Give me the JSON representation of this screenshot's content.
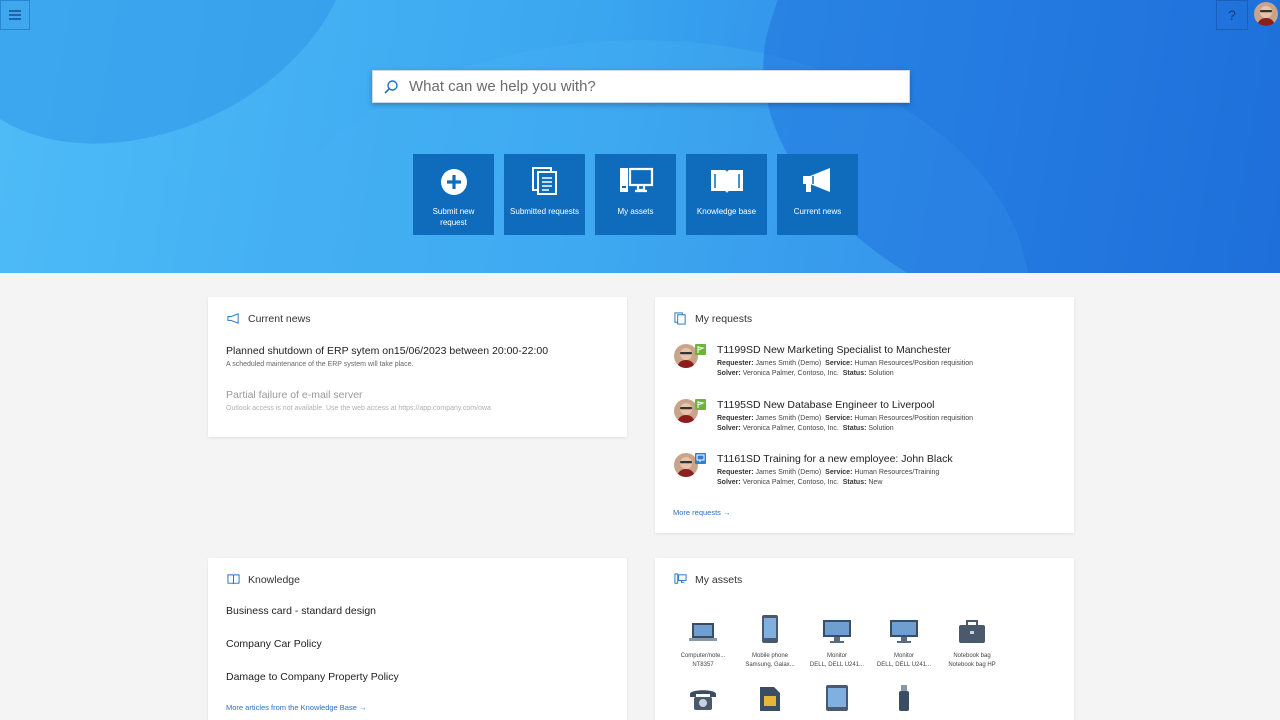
{
  "search": {
    "placeholder": "What can we help you with?"
  },
  "header": {
    "help_label": "?"
  },
  "tiles": [
    {
      "label": "Submit new request",
      "icon": "plus-circle-icon"
    },
    {
      "label": "Submitted requests",
      "icon": "documents-icon"
    },
    {
      "label": "My assets",
      "icon": "computer-icon"
    },
    {
      "label": "Knowledge base",
      "icon": "book-icon"
    },
    {
      "label": "Current news",
      "icon": "megaphone-icon"
    }
  ],
  "news": {
    "title": "Current news",
    "items": [
      {
        "title": "Planned shutdown of ERP sytem on15/06/2023 between 20:00-22:00",
        "subtitle": "A scheduled maintenance of the ERP system will take place."
      },
      {
        "title": "Partial failure of e-mail server",
        "subtitle": "Outlook access is not available. Use the web access at https://app.company.com/owa"
      }
    ]
  },
  "requests": {
    "title": "My requests",
    "labels": {
      "requester": "Requester:",
      "service": "Service:",
      "solver": "Solver:",
      "status": "Status:"
    },
    "items": [
      {
        "title": "T1199SD New Marketing Specialist to Manchester",
        "requester": "James Smith (Demo)",
        "service": "Human Resources/Position requisition",
        "solver": "Veronica Palmer, Contoso, Inc.",
        "status": "Solution",
        "badge_color": "#6bb53a"
      },
      {
        "title": "T1195SD New Database Engineer to Liverpool",
        "requester": "James Smith (Demo)",
        "service": "Human Resources/Position requisition",
        "solver": "Veronica Palmer, Contoso, Inc.",
        "status": "Solution",
        "badge_color": "#6bb53a"
      },
      {
        "title": "T1161SD Training for a new employee: John Black",
        "requester": "James Smith (Demo)",
        "service": "Human Resources/Training",
        "solver": "Veronica Palmer, Contoso, Inc.",
        "status": "New",
        "badge_color": "#2f7fd1"
      }
    ],
    "more": "More requests →"
  },
  "knowledge": {
    "title": "Knowledge",
    "items": [
      {
        "label": "Business card - standard design"
      },
      {
        "label": "Company Car Policy"
      },
      {
        "label": "Damage to Company Property Policy"
      }
    ],
    "more": "More articles from the Knowledge Base →"
  },
  "assets": {
    "title": "My assets",
    "items": [
      {
        "type": "Computer/note...",
        "name": "NT8357",
        "icon": "laptop-icon"
      },
      {
        "type": "Mobile phone",
        "name": "Samsung, Galax...",
        "icon": "mobile-phone-icon"
      },
      {
        "type": "Monitor",
        "name": "DELL, DELL U241...",
        "icon": "monitor-icon"
      },
      {
        "type": "Monitor",
        "name": "DELL, DELL U241...",
        "icon": "monitor-icon"
      },
      {
        "type": "Notebook bag",
        "name": "Notebook bag HP",
        "icon": "briefcase-icon"
      },
      {
        "type": "Phone",
        "name": "",
        "icon": "telephone-icon"
      },
      {
        "type": "SIM card",
        "name": "",
        "icon": "sim-card-icon"
      },
      {
        "type": "Tablet",
        "name": "",
        "icon": "tablet-icon"
      },
      {
        "type": "USB flash drive",
        "name": "",
        "icon": "usb-drive-icon"
      }
    ]
  },
  "colors": {
    "tile": "#0f6cbd",
    "link": "#2f6fbf",
    "hero_light": "#4ebcf7",
    "hero_dark": "#1e6bd6"
  }
}
